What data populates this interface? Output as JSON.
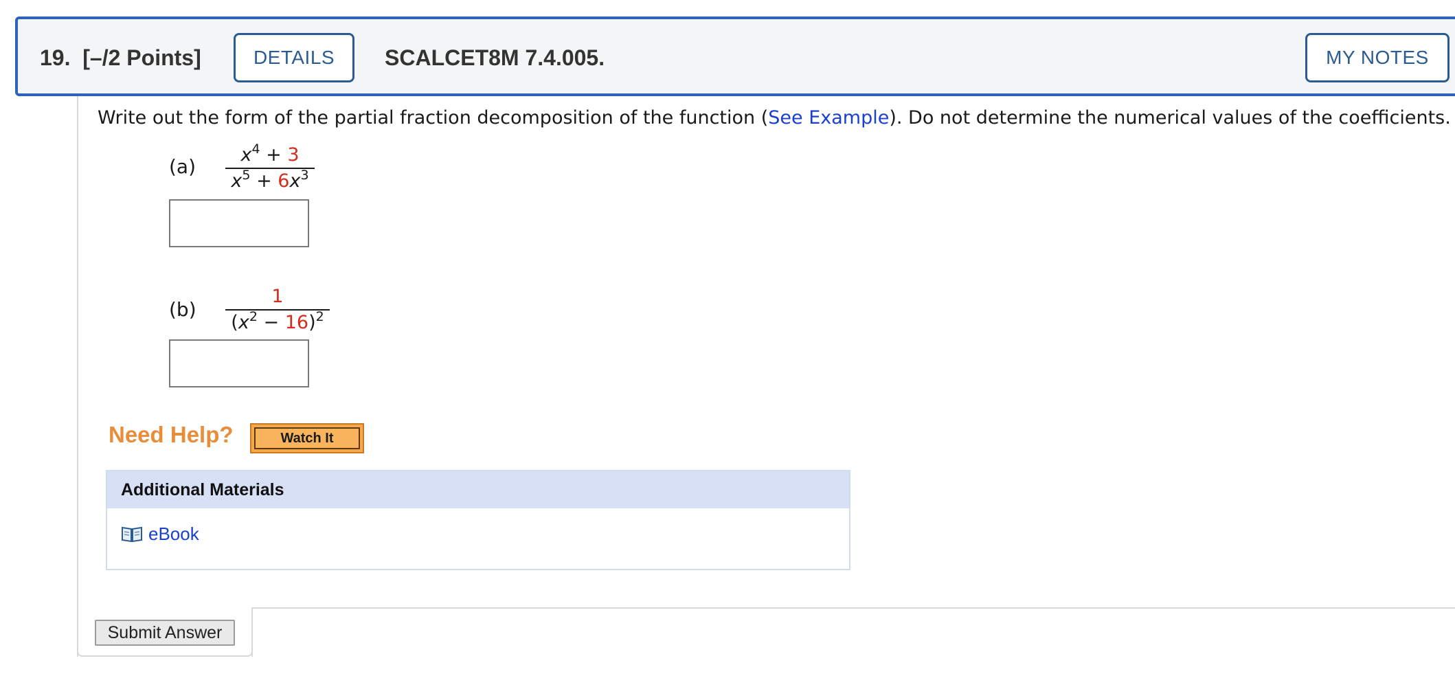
{
  "header": {
    "question_number": "19.",
    "points": "[–/2 Points]",
    "details_label": "DETAILS",
    "question_id": "SCALCET8M 7.4.005.",
    "my_notes_label": "MY NOTES"
  },
  "prompt": {
    "before_link": "Write out the form of the partial fraction decomposition of the function (",
    "link_text": "See Example",
    "after_link": "). Do not determine the numerical values of the coefficients."
  },
  "parts": [
    {
      "label": "(a)",
      "numerator": {
        "var": "x",
        "exp": "4",
        "op": " + ",
        "const": "3"
      },
      "denominator": {
        "var1": "x",
        "exp1": "5",
        "op": " + ",
        "coef": "6",
        "var2": "x",
        "exp2": "3"
      },
      "answer_value": ""
    },
    {
      "label": "(b)",
      "numerator": {
        "const": "1"
      },
      "denominator": {
        "open": "(",
        "var": "x",
        "exp": "2",
        "op": " − ",
        "const": "16",
        "close": ")",
        "outer_exp": "2"
      },
      "answer_value": ""
    }
  ],
  "help": {
    "need_help_label": "Need Help?",
    "watch_it_label": "Watch It"
  },
  "additional_materials": {
    "title": "Additional Materials",
    "items": [
      {
        "label": "eBook",
        "icon": "book-icon"
      }
    ]
  },
  "submit_label": "Submit Answer",
  "colors": {
    "header_border": "#2d63b8",
    "button_text": "#2b5c91",
    "link": "#1a3fd1",
    "highlight_red": "#d22d1e",
    "need_help_orange": "#e98d3a",
    "materials_header_bg": "#d7e0f4"
  }
}
